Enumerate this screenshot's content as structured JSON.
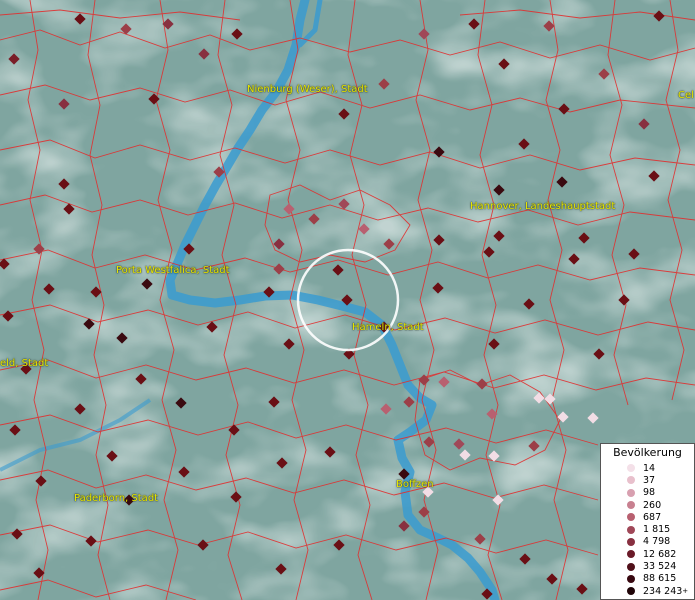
{
  "map": {
    "colors": {
      "background": "#7fa5a0",
      "border": "#e03030",
      "river": "#3a9bd0",
      "marker_dark": "#6a0f15",
      "marker_mid": "#9c3f48",
      "marker_light": "#f2dde5",
      "label": "#e8e800"
    },
    "labels": [
      {
        "id": "nienburg",
        "text": "Nienburg (Weser), Stadt"
      },
      {
        "id": "celle",
        "text": "Cel"
      },
      {
        "id": "hannover",
        "text": "Hannover, Landeshauptstadt"
      },
      {
        "id": "porta",
        "text": "Porta Westfalica, Stadt"
      },
      {
        "id": "hameln",
        "text": "Hameln, Stadt"
      },
      {
        "id": "bielefeld",
        "text": "eld, Stadt"
      },
      {
        "id": "paderborn",
        "text": "Paderborn, Stadt"
      },
      {
        "id": "boffzen",
        "text": "Boffzen"
      }
    ]
  },
  "legend": {
    "title": "Bevölkerung",
    "items": [
      {
        "label": "14",
        "color": "#f4e0e8"
      },
      {
        "label": "37",
        "color": "#e8c0cc"
      },
      {
        "label": "98",
        "color": "#d8a0b0"
      },
      {
        "label": "260",
        "color": "#c88090"
      },
      {
        "label": "687",
        "color": "#b86070"
      },
      {
        "label": "1 815",
        "color": "#a04858"
      },
      {
        "label": "4 798",
        "color": "#883040"
      },
      {
        "label": "12 682",
        "color": "#6a1a28"
      },
      {
        "label": "33 524",
        "color": "#50101a"
      },
      {
        "label": "88 615",
        "color": "#380810"
      },
      {
        "label": "234 243",
        "color": "#200408"
      }
    ],
    "plus": "+"
  }
}
